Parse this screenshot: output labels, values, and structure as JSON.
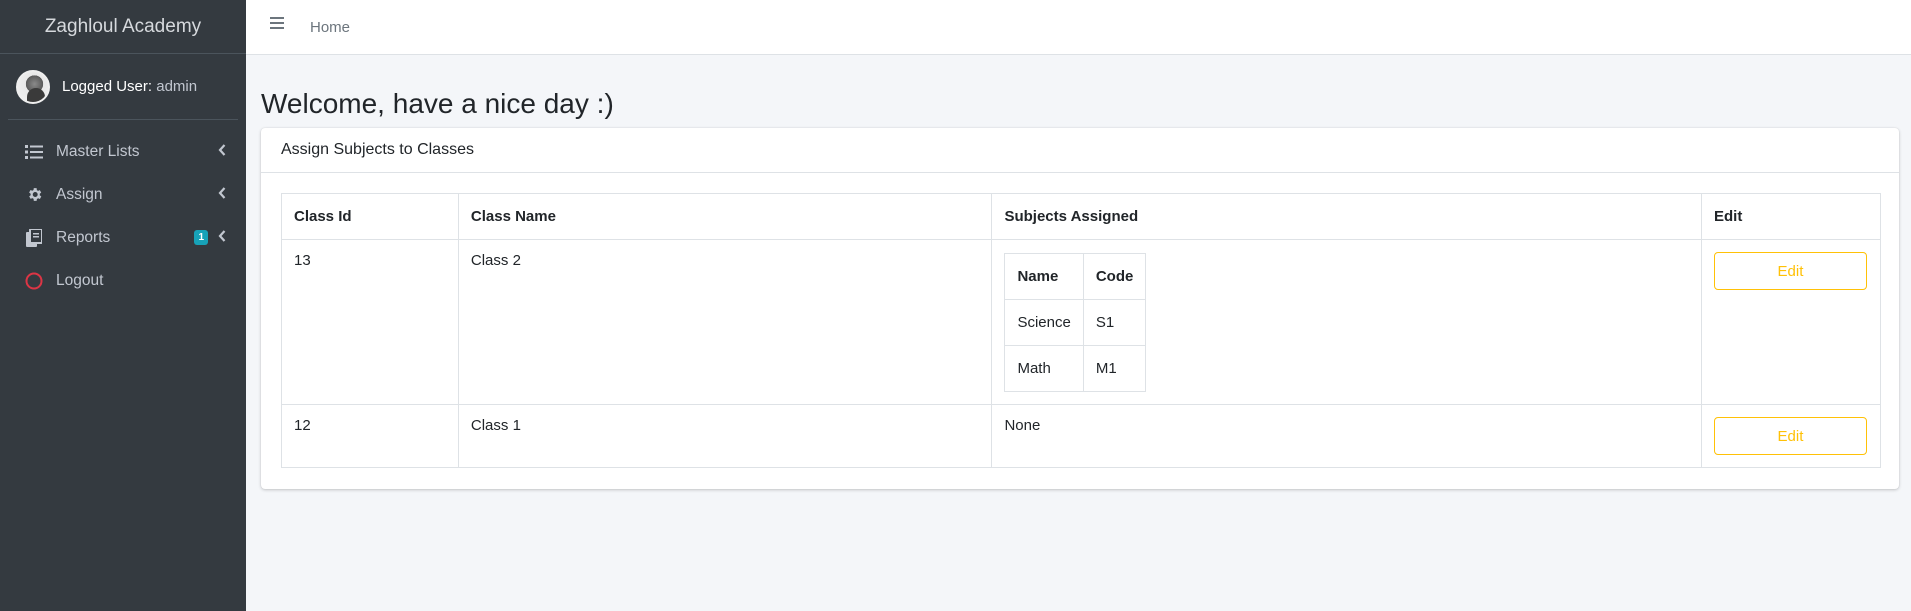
{
  "app": {
    "brand": "Zaghloul Academy"
  },
  "user": {
    "label": "Logged User:",
    "name": "admin"
  },
  "sidebar": {
    "items": [
      {
        "label": "Master Lists",
        "icon": "list-icon",
        "has_arrow": true
      },
      {
        "label": "Assign",
        "icon": "gear-icon",
        "has_arrow": true
      },
      {
        "label": "Reports",
        "icon": "copy-icon",
        "badge": "1",
        "has_arrow": true
      },
      {
        "label": "Logout",
        "icon": "circle-icon",
        "has_arrow": false
      }
    ]
  },
  "topbar": {
    "home": "Home"
  },
  "page": {
    "title": "Welcome, have a nice day :)"
  },
  "card": {
    "title": "Assign Subjects to Classes",
    "headers": [
      "Class Id",
      "Class Name",
      "Subjects Assigned",
      "Edit"
    ],
    "subject_headers": [
      "Name",
      "Code"
    ],
    "rows": [
      {
        "class_id": "13",
        "class_name": "Class 2",
        "subjects": [
          {
            "name": "Science",
            "code": "S1"
          },
          {
            "name": "Math",
            "code": "M1"
          }
        ],
        "edit_label": "Edit"
      },
      {
        "class_id": "12",
        "class_name": "Class 1",
        "none_text": "None",
        "edit_label": "Edit"
      }
    ]
  },
  "colors": {
    "sidebar_bg": "#343a40",
    "accent_warning": "#ffc107",
    "badge": "#17a2b8"
  }
}
